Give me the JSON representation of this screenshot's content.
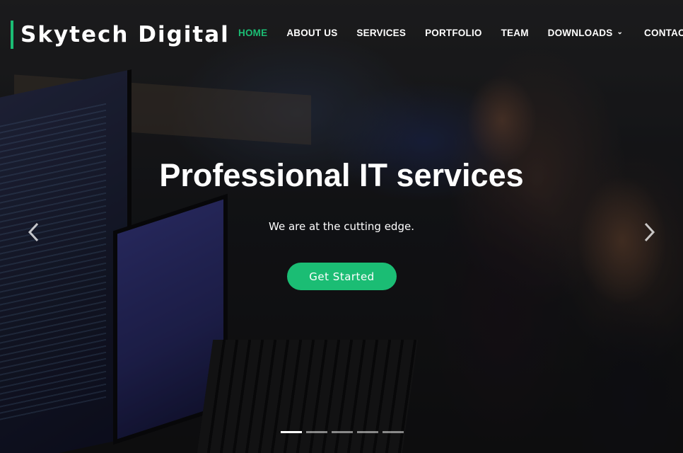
{
  "brand": {
    "name": "Skytech Digital",
    "accent_color": "#1bbd74"
  },
  "nav": {
    "items": [
      {
        "label": "HOME",
        "active": true
      },
      {
        "label": "ABOUT US"
      },
      {
        "label": "SERVICES"
      },
      {
        "label": "PORTFOLIO"
      },
      {
        "label": "TEAM"
      },
      {
        "label": "DOWNLOADS",
        "has_dropdown": true,
        "icon": "chevron-down-icon"
      },
      {
        "label": "CONTACT"
      }
    ],
    "dropdown_caret": "⌄"
  },
  "hero": {
    "title": "Professional IT services",
    "subtitle": "We are at the cutting edge.",
    "cta_label": "Get Started",
    "prev_icon": "chevron-left-icon",
    "next_icon": "chevron-right-icon",
    "slide_count": 5,
    "active_slide": 1
  }
}
